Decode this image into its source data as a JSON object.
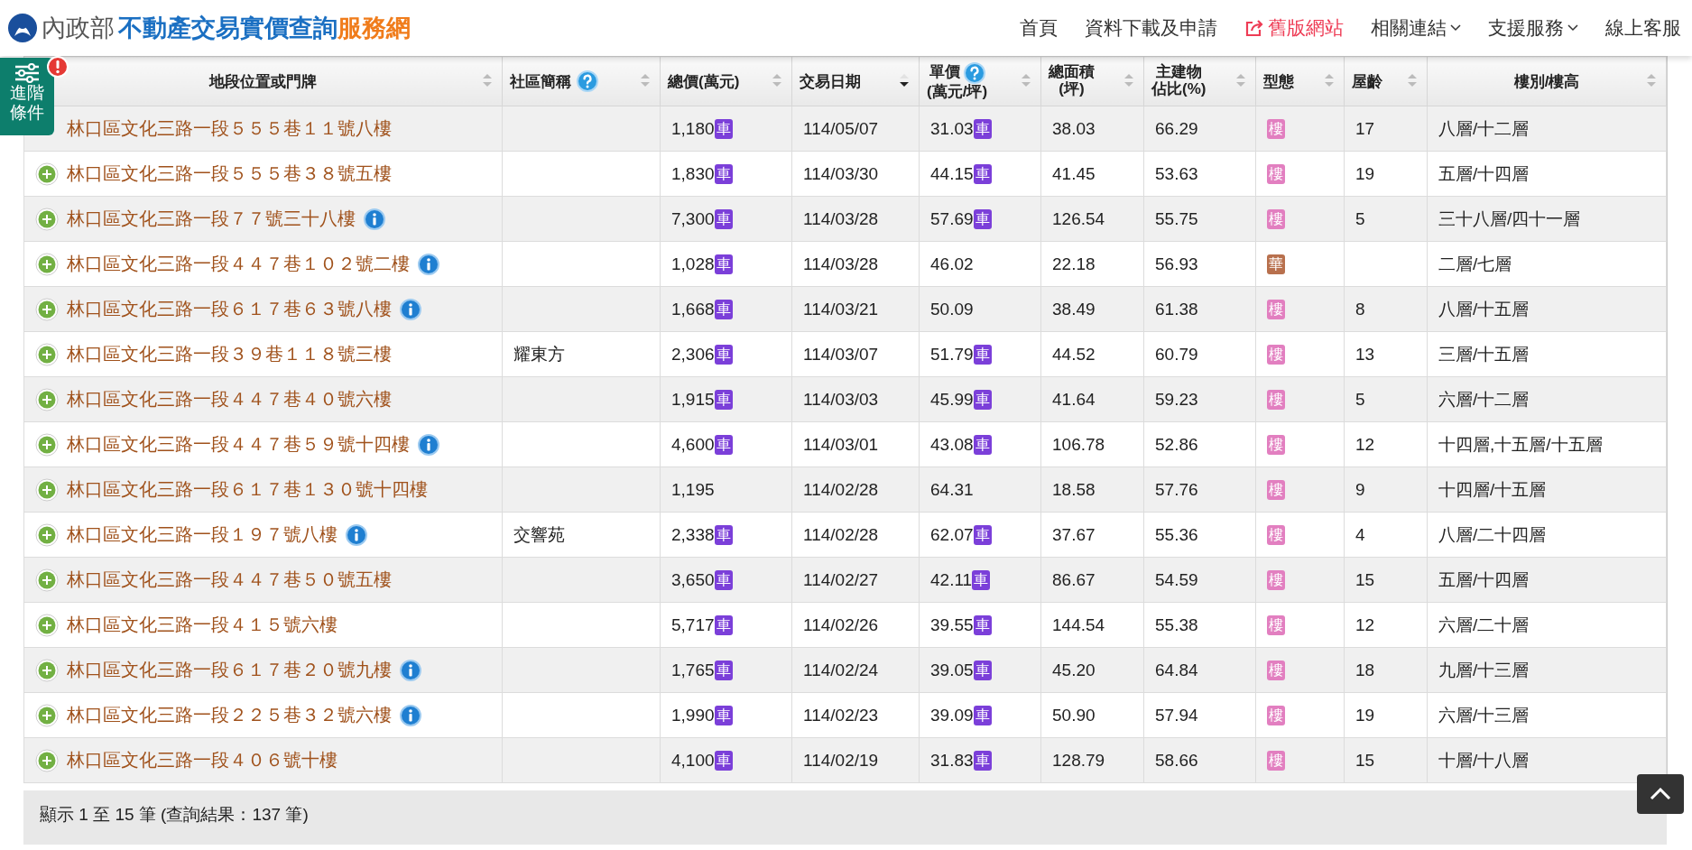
{
  "header": {
    "logo_ministry": "內政部",
    "logo_title": "不動產交易實價查詢",
    "logo_suffix": "服務網",
    "nav": [
      {
        "label": "首頁",
        "kind": "plain"
      },
      {
        "label": "資料下載及申請",
        "kind": "plain"
      },
      {
        "label": "舊版網站",
        "kind": "external"
      },
      {
        "label": "相關連結",
        "kind": "dropdown"
      },
      {
        "label": "支援服務",
        "kind": "dropdown"
      },
      {
        "label": "線上客服",
        "kind": "plain"
      }
    ]
  },
  "advanced_filter": {
    "label": "進階條件",
    "alert": true
  },
  "table": {
    "columns": [
      {
        "lines": [
          "地段位置或門牌"
        ],
        "sorted": false,
        "help": false
      },
      {
        "lines": [
          "社區簡稱"
        ],
        "sorted": false,
        "help": true
      },
      {
        "lines": [
          "總價(萬元)"
        ],
        "sorted": false,
        "help": false
      },
      {
        "lines": [
          "交易日期"
        ],
        "sorted": true,
        "help": false
      },
      {
        "lines": [
          "單價",
          "(萬元/坪)"
        ],
        "sorted": false,
        "help": true
      },
      {
        "lines": [
          "總面積",
          "(坪)"
        ],
        "sorted": false,
        "help": false
      },
      {
        "lines": [
          "主建物",
          "佔比(%)"
        ],
        "sorted": false,
        "help": false
      },
      {
        "lines": [
          "型態"
        ],
        "sorted": false,
        "help": false
      },
      {
        "lines": [
          "屋齡"
        ],
        "sorted": false,
        "help": false
      },
      {
        "lines": [
          "樓別/樓高"
        ],
        "sorted": false,
        "help": false
      }
    ],
    "rows": [
      {
        "address": "林口區文化三路一段５５５巷１１號八樓",
        "info": false,
        "expand_visible": false,
        "community": "",
        "price": "1,180",
        "price_badge": "車",
        "date": "114/05/07",
        "unit_price": "31.03",
        "unit_badge": "車",
        "area": "38.03",
        "main_ratio": "66.29",
        "type": {
          "label": "樓",
          "color": "#e27fc0"
        },
        "age": "17",
        "floor": "八層/十二層"
      },
      {
        "address": "林口區文化三路一段５５５巷３８號五樓",
        "info": false,
        "expand_visible": true,
        "community": "",
        "price": "1,830",
        "price_badge": "車",
        "date": "114/03/30",
        "unit_price": "44.15",
        "unit_badge": "車",
        "area": "41.45",
        "main_ratio": "53.63",
        "type": {
          "label": "樓",
          "color": "#e27fc0"
        },
        "age": "19",
        "floor": "五層/十四層"
      },
      {
        "address": "林口區文化三路一段７７號三十八樓",
        "info": true,
        "expand_visible": true,
        "community": "",
        "price": "7,300",
        "price_badge": "車",
        "date": "114/03/28",
        "unit_price": "57.69",
        "unit_badge": "車",
        "area": "126.54",
        "main_ratio": "55.75",
        "type": {
          "label": "樓",
          "color": "#e27fc0"
        },
        "age": "5",
        "floor": "三十八層/四十一層"
      },
      {
        "address": "林口區文化三路一段４４７巷１０２號二樓",
        "info": true,
        "expand_visible": true,
        "community": "",
        "price": "1,028",
        "price_badge": "車",
        "date": "114/03/28",
        "unit_price": "46.02",
        "unit_badge": "",
        "area": "22.18",
        "main_ratio": "56.93",
        "type": {
          "label": "華",
          "color": "#b8704d"
        },
        "age": "",
        "floor": "二層/七層"
      },
      {
        "address": "林口區文化三路一段６１７巷６３號八樓",
        "info": true,
        "expand_visible": true,
        "community": "",
        "price": "1,668",
        "price_badge": "車",
        "date": "114/03/21",
        "unit_price": "50.09",
        "unit_badge": "",
        "area": "38.49",
        "main_ratio": "61.38",
        "type": {
          "label": "樓",
          "color": "#e27fc0"
        },
        "age": "8",
        "floor": "八層/十五層"
      },
      {
        "address": "林口區文化三路一段３９巷１１８號三樓",
        "info": false,
        "expand_visible": true,
        "community": "耀東方",
        "price": "2,306",
        "price_badge": "車",
        "date": "114/03/07",
        "unit_price": "51.79",
        "unit_badge": "車",
        "area": "44.52",
        "main_ratio": "60.79",
        "type": {
          "label": "樓",
          "color": "#e27fc0"
        },
        "age": "13",
        "floor": "三層/十五層"
      },
      {
        "address": "林口區文化三路一段４４７巷４０號六樓",
        "info": false,
        "expand_visible": true,
        "community": "",
        "price": "1,915",
        "price_badge": "車",
        "date": "114/03/03",
        "unit_price": "45.99",
        "unit_badge": "車",
        "area": "41.64",
        "main_ratio": "59.23",
        "type": {
          "label": "樓",
          "color": "#e27fc0"
        },
        "age": "5",
        "floor": "六層/十二層"
      },
      {
        "address": "林口區文化三路一段４４７巷５９號十四樓",
        "info": true,
        "expand_visible": true,
        "community": "",
        "price": "4,600",
        "price_badge": "車",
        "date": "114/03/01",
        "unit_price": "43.08",
        "unit_badge": "車",
        "area": "106.78",
        "main_ratio": "52.86",
        "type": {
          "label": "樓",
          "color": "#e27fc0"
        },
        "age": "12",
        "floor": "十四層,十五層/十五層"
      },
      {
        "address": "林口區文化三路一段６１７巷１３０號十四樓",
        "info": false,
        "expand_visible": true,
        "community": "",
        "price": "1,195",
        "price_badge": "",
        "date": "114/02/28",
        "unit_price": "64.31",
        "unit_badge": "",
        "area": "18.58",
        "main_ratio": "57.76",
        "type": {
          "label": "樓",
          "color": "#e27fc0"
        },
        "age": "9",
        "floor": "十四層/十五層"
      },
      {
        "address": "林口區文化三路一段１９７號八樓",
        "info": true,
        "expand_visible": true,
        "community": "交響苑",
        "price": "2,338",
        "price_badge": "車",
        "date": "114/02/28",
        "unit_price": "62.07",
        "unit_badge": "車",
        "area": "37.67",
        "main_ratio": "55.36",
        "type": {
          "label": "樓",
          "color": "#e27fc0"
        },
        "age": "4",
        "floor": "八層/二十四層"
      },
      {
        "address": "林口區文化三路一段４４７巷５０號五樓",
        "info": false,
        "expand_visible": true,
        "community": "",
        "price": "3,650",
        "price_badge": "車",
        "date": "114/02/27",
        "unit_price": "42.11",
        "unit_badge": "車",
        "area": "86.67",
        "main_ratio": "54.59",
        "type": {
          "label": "樓",
          "color": "#e27fc0"
        },
        "age": "15",
        "floor": "五層/十四層"
      },
      {
        "address": "林口區文化三路一段４１５號六樓",
        "info": false,
        "expand_visible": true,
        "community": "",
        "price": "5,717",
        "price_badge": "車",
        "date": "114/02/26",
        "unit_price": "39.55",
        "unit_badge": "車",
        "area": "144.54",
        "main_ratio": "55.38",
        "type": {
          "label": "樓",
          "color": "#e27fc0"
        },
        "age": "12",
        "floor": "六層/二十層"
      },
      {
        "address": "林口區文化三路一段６１７巷２０號九樓",
        "info": true,
        "expand_visible": true,
        "community": "",
        "price": "1,765",
        "price_badge": "車",
        "date": "114/02/24",
        "unit_price": "39.05",
        "unit_badge": "車",
        "area": "45.20",
        "main_ratio": "64.84",
        "type": {
          "label": "樓",
          "color": "#e27fc0"
        },
        "age": "18",
        "floor": "九層/十三層"
      },
      {
        "address": "林口區文化三路一段２２５巷３２號六樓",
        "info": true,
        "expand_visible": true,
        "community": "",
        "price": "1,990",
        "price_badge": "車",
        "date": "114/02/23",
        "unit_price": "39.09",
        "unit_badge": "車",
        "area": "50.90",
        "main_ratio": "57.94",
        "type": {
          "label": "樓",
          "color": "#e27fc0"
        },
        "age": "19",
        "floor": "六層/十三層"
      },
      {
        "address": "林口區文化三路一段４０６號十樓",
        "info": false,
        "expand_visible": true,
        "community": "",
        "price": "4,100",
        "price_badge": "車",
        "date": "114/02/19",
        "unit_price": "31.83",
        "unit_badge": "車",
        "area": "128.79",
        "main_ratio": "58.66",
        "type": {
          "label": "樓",
          "color": "#e27fc0"
        },
        "age": "15",
        "floor": "十層/十八層"
      }
    ]
  },
  "pager_summary": "顯示 1 至 15 筆 (查詢結果：137 筆)"
}
